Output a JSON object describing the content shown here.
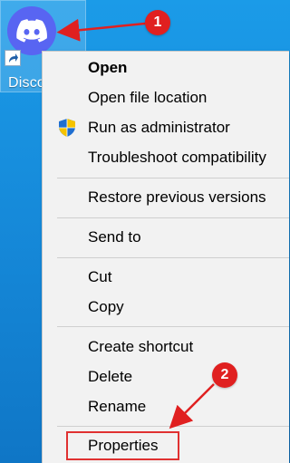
{
  "desktop": {
    "icon_label": "Disco",
    "icon_name": "discord-logo-icon",
    "shortcut_badge_icon": "shortcut-arrow-icon",
    "brand_color": "#5865F2"
  },
  "context_menu": {
    "items": [
      {
        "label": "Open",
        "bold": true
      },
      {
        "label": "Open file location"
      },
      {
        "label": "Run as administrator",
        "icon": "uac-shield-icon"
      },
      {
        "label": "Troubleshoot compatibility"
      },
      {
        "label": "Restore previous versions"
      },
      {
        "label": "Send to"
      },
      {
        "label": "Cut"
      },
      {
        "label": "Copy"
      },
      {
        "label": "Create shortcut"
      },
      {
        "label": "Delete"
      },
      {
        "label": "Rename"
      },
      {
        "label": "Properties",
        "highlighted": true
      }
    ]
  },
  "annotations": {
    "step1": "1",
    "step2": "2",
    "color": "#E02020"
  }
}
